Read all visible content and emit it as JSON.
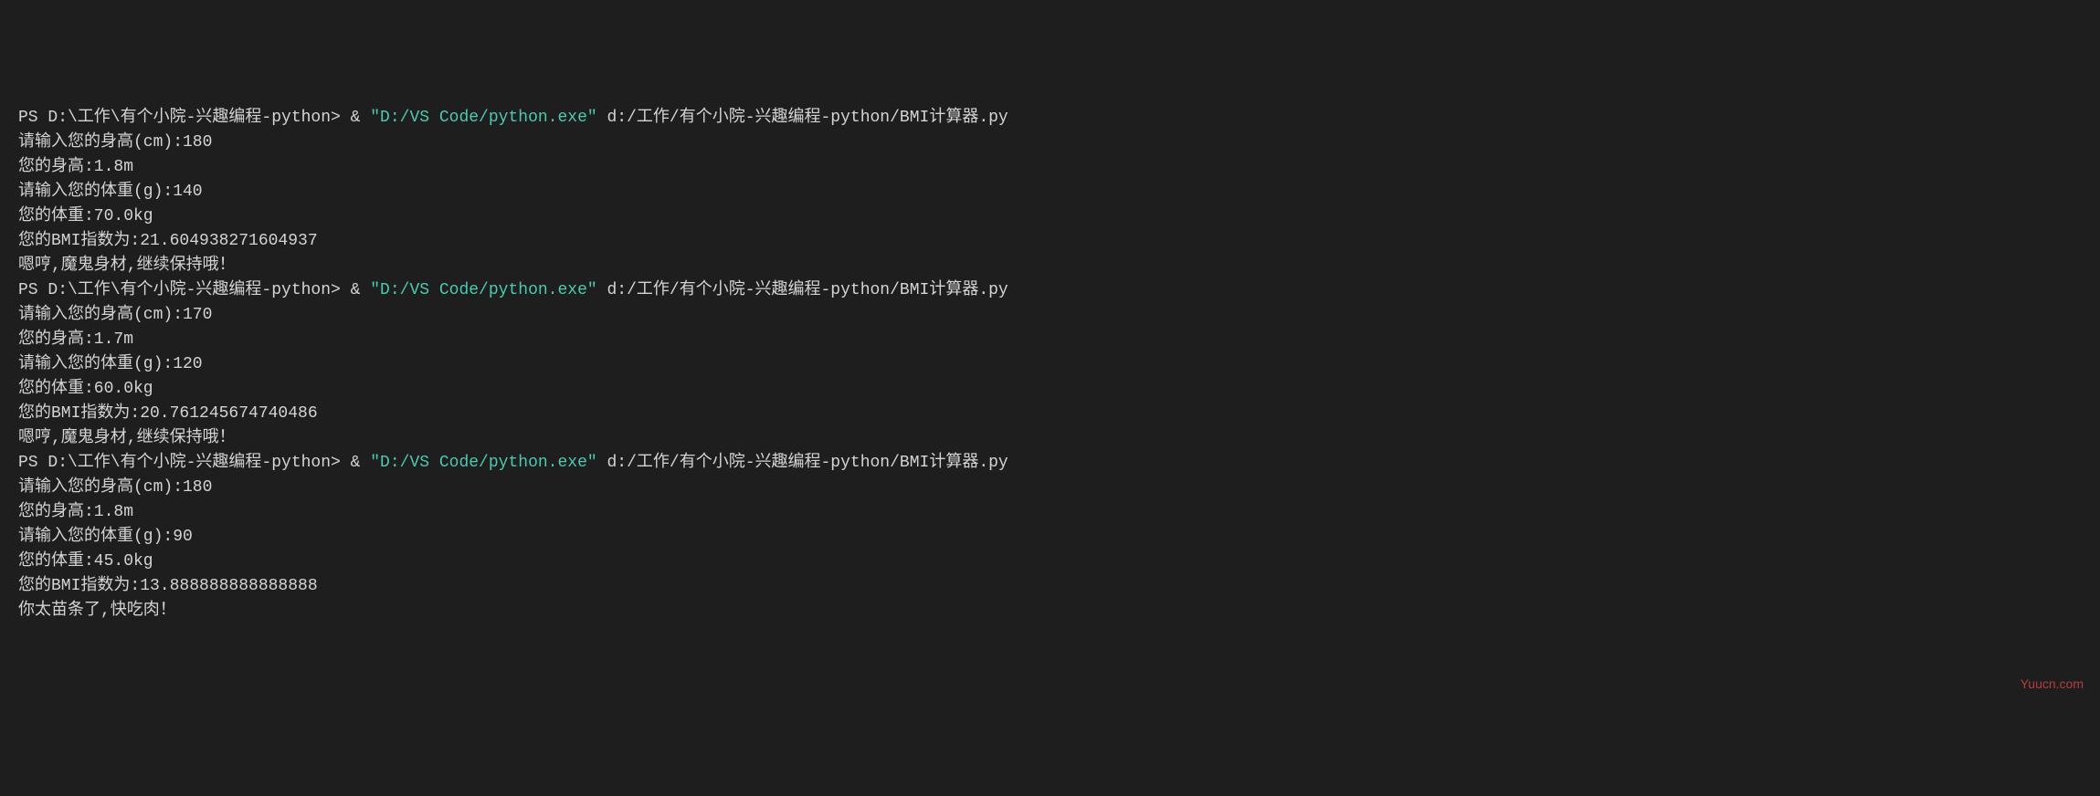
{
  "runs": [
    {
      "prompt_prefix": "PS D:\\工作\\有个小院-兴趣编程-python> & ",
      "exe_path": "\"D:/VS Code/python.exe\"",
      "script_arg": " d:/工作/有个小院-兴趣编程-python/BMI计算器.py",
      "lines": [
        "请输入您的身高(cm):180",
        "您的身高:1.8m",
        "请输入您的体重(g):140",
        "您的体重:70.0kg",
        "您的BMI指数为:21.604938271604937",
        "嗯哼,魔鬼身材,继续保持哦！"
      ]
    },
    {
      "prompt_prefix": "PS D:\\工作\\有个小院-兴趣编程-python> & ",
      "exe_path": "\"D:/VS Code/python.exe\"",
      "script_arg": " d:/工作/有个小院-兴趣编程-python/BMI计算器.py",
      "lines": [
        "请输入您的身高(cm):170",
        "您的身高:1.7m",
        "请输入您的体重(g):120",
        "您的体重:60.0kg",
        "您的BMI指数为:20.761245674740486",
        "嗯哼,魔鬼身材,继续保持哦！"
      ]
    },
    {
      "prompt_prefix": "PS D:\\工作\\有个小院-兴趣编程-python> & ",
      "exe_path": "\"D:/VS Code/python.exe\"",
      "script_arg": " d:/工作/有个小院-兴趣编程-python/BMI计算器.py",
      "lines": [
        "请输入您的身高(cm):180",
        "您的身高:1.8m",
        "请输入您的体重(g):90",
        "您的体重:45.0kg",
        "您的BMI指数为:13.888888888888888",
        "你太苗条了,快吃肉！"
      ]
    }
  ],
  "watermark": "Yuucn.com"
}
